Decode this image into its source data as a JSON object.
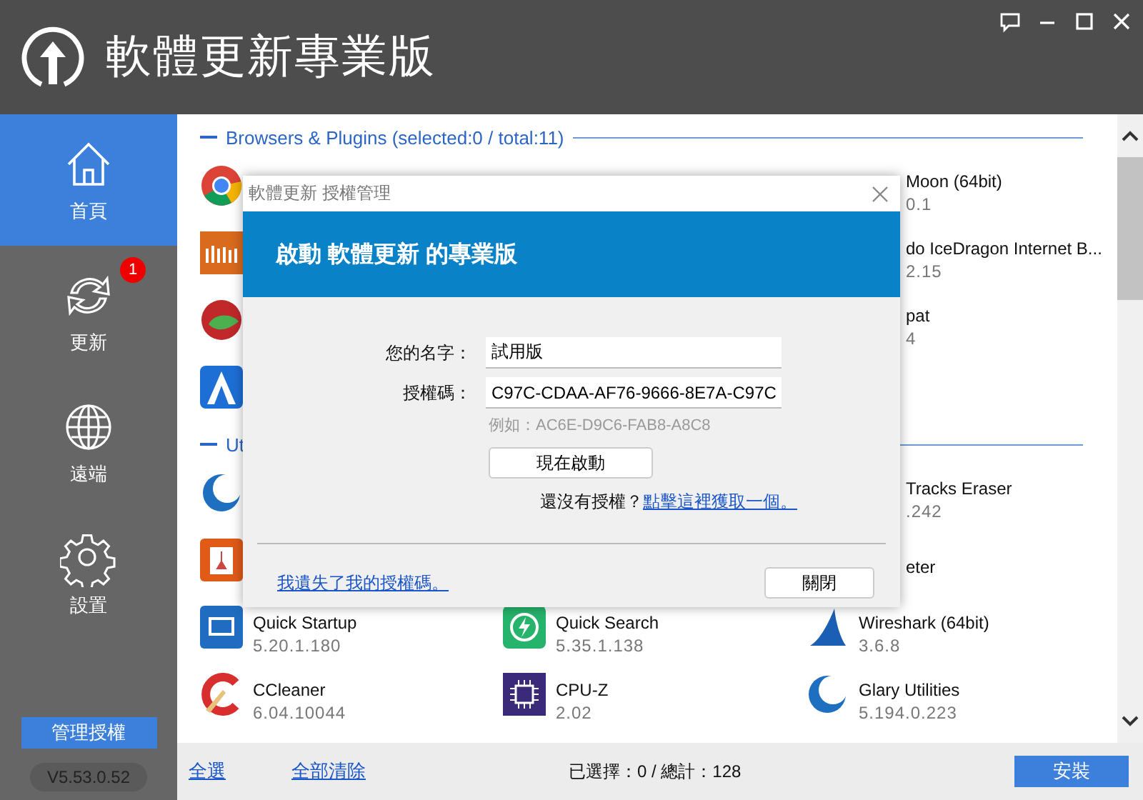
{
  "header": {
    "title": "軟體更新專業版"
  },
  "sidebar": {
    "items": [
      {
        "label": "首頁",
        "selected": true
      },
      {
        "label": "更新",
        "selected": false,
        "badge": "1"
      },
      {
        "label": "遠端",
        "selected": false
      },
      {
        "label": "設置",
        "selected": false
      }
    ],
    "license_button": "管理授權",
    "version": "V5.53.0.52"
  },
  "sections": [
    {
      "title": "Browsers & Plugins (selected:0 / total:11)",
      "rows": [
        [
          {
            "kind": "icon"
          },
          {
            "kind": "empty"
          },
          {
            "kind": "clipped",
            "name": "Moon (64bit)",
            "version": "0.1"
          }
        ],
        [
          {
            "kind": "icon"
          },
          {
            "kind": "empty"
          },
          {
            "kind": "clipped",
            "name": "do IceDragon Internet B...",
            "version": "2.15"
          }
        ],
        [
          {
            "kind": "icon"
          },
          {
            "kind": "empty"
          },
          {
            "kind": "clipped",
            "name": "pat",
            "version": "4"
          }
        ],
        [
          {
            "kind": "icon"
          },
          {
            "kind": "empty"
          },
          {
            "kind": "empty"
          }
        ]
      ]
    },
    {
      "title": "Ut",
      "rows": [
        [
          {
            "kind": "icon"
          },
          {
            "kind": "empty"
          },
          {
            "kind": "clipped",
            "name": "Tracks Eraser",
            "version": ".242"
          }
        ],
        [
          {
            "kind": "icon"
          },
          {
            "kind": "empty"
          },
          {
            "kind": "clipped",
            "name": "eter"
          }
        ],
        [
          {
            "kind": "full",
            "name": "Quick Startup",
            "version": "5.20.1.180"
          },
          {
            "kind": "full",
            "name": "Quick Search",
            "version": "5.35.1.138"
          },
          {
            "kind": "full",
            "name": "Wireshark (64bit)",
            "version": "3.6.8"
          }
        ],
        [
          {
            "kind": "full",
            "name": "CCleaner",
            "version": "6.04.10044"
          },
          {
            "kind": "full",
            "name": "CPU-Z",
            "version": "2.02"
          },
          {
            "kind": "full",
            "name": "Glary Utilities",
            "version": "5.194.0.223"
          }
        ]
      ]
    }
  ],
  "footer": {
    "select_all": "全選",
    "clear_all": "全部清除",
    "summary": "已選擇：0 / 總計：128",
    "install": "安裝"
  },
  "dialog": {
    "title": "軟體更新 授權管理",
    "heading": "啟動 軟體更新 的專業版",
    "fields": [
      {
        "label": "您的名字：",
        "value": "試用版"
      },
      {
        "label": "授權碼：",
        "value": "C97C-CDAA-AF76-9666-8E7A-C97C"
      }
    ],
    "example": "例如：AC6E-D9C6-FAB8-A8C8",
    "activate_button": "現在啟動",
    "prompt": "還沒有授權？",
    "prompt_link": "點擊這裡獲取一個。",
    "lost_link": "我遺失了我的授權碼。",
    "close_button": "關閉"
  }
}
